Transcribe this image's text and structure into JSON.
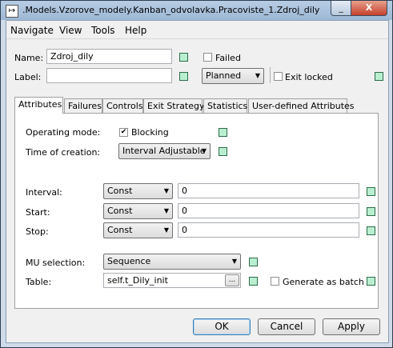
{
  "window": {
    "title": ".Models.Vzorove_modely.Kanban_odvolavka.Pracoviste_1.Zdroj_dily",
    "icon": "arrow-into-box-icon",
    "minimize_glyph": "_",
    "close_glyph": "X"
  },
  "menu": [
    "Navigate",
    "View",
    "Tools",
    "Help"
  ],
  "header": {
    "name_label": "Name:",
    "name_value": "Zdroj_dily",
    "label_label": "Label:",
    "label_value": "",
    "failed_label": "Failed",
    "failed_checked": false,
    "planned_value": "Planned",
    "exit_locked_label": "Exit locked",
    "exit_locked_checked": false
  },
  "tabs": [
    "Attributes",
    "Failures",
    "Controls",
    "Exit Strategy",
    "Statistics",
    "User-defined Attributes"
  ],
  "active_tab": "Attributes",
  "attributes": {
    "operating_mode_label": "Operating mode:",
    "blocking_label": "Blocking",
    "blocking_checked": true,
    "time_of_creation_label": "Time of creation:",
    "time_of_creation_value": "Interval Adjustable",
    "interval_label": "Interval:",
    "interval_type": "Const",
    "interval_value": "0",
    "start_label": "Start:",
    "start_type": "Const",
    "start_value": "0",
    "stop_label": "Stop:",
    "stop_type": "Const",
    "stop_value": "0",
    "mu_selection_label": "MU selection:",
    "mu_selection_value": "Sequence",
    "table_label": "Table:",
    "table_value": "self.t_Dily_init",
    "browse_label": "...",
    "generate_batch_label": "Generate as batch",
    "generate_batch_checked": false
  },
  "buttons": {
    "ok": "OK",
    "cancel": "Cancel",
    "apply": "Apply"
  },
  "glyphs": {
    "dropdown": "▼",
    "check": "✔"
  },
  "colors": {
    "inheritance_marker": "#b9efd0",
    "titlebar": "#9db7d4",
    "close_button": "#c4412b"
  }
}
